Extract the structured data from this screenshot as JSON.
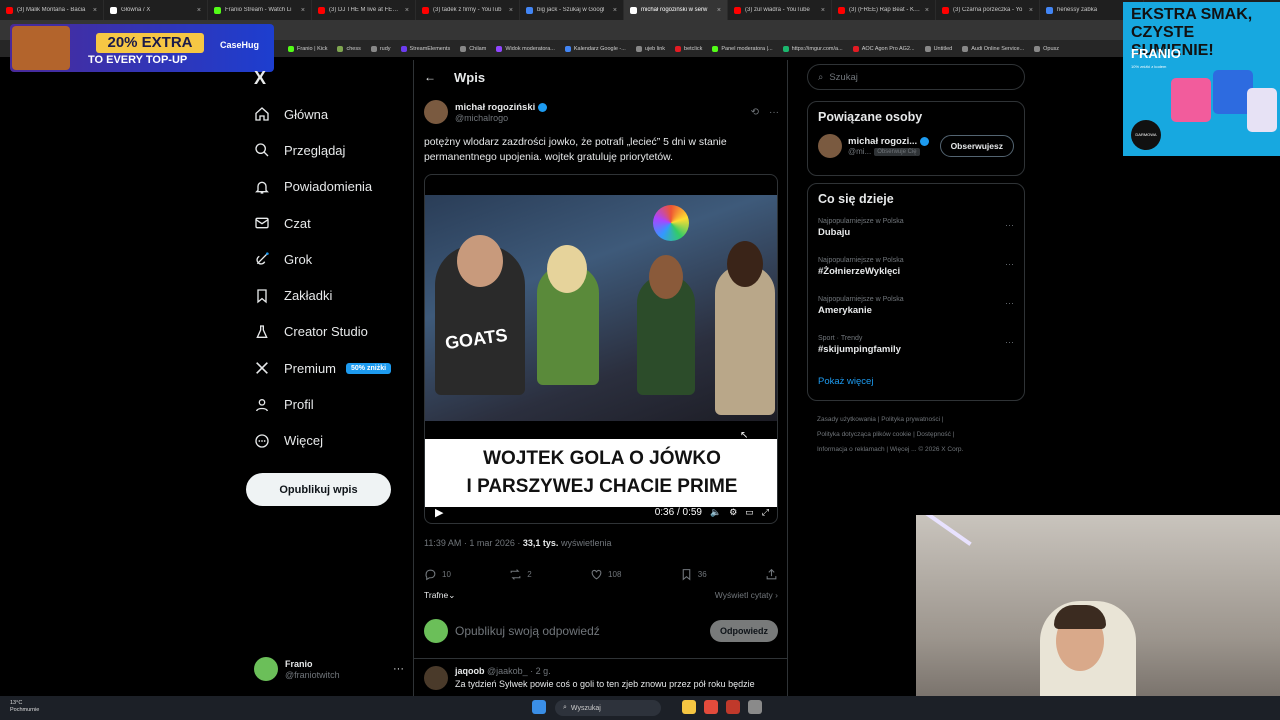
{
  "browser": {
    "tabs": [
      {
        "title": "(3) Malik Montana - Bacia",
        "color": "#ff0000"
      },
      {
        "title": "Główna / X",
        "color": "#ffffff"
      },
      {
        "title": "Franio Stream - Watch Li",
        "color": "#53fc18"
      },
      {
        "title": "(3) DJ THE M live at FESTI",
        "color": "#ff0000"
      },
      {
        "title": "(3) tadek z firmy - YouTub",
        "color": "#ff0000"
      },
      {
        "title": "big jack - Szukaj w Googl",
        "color": "#4285f4"
      },
      {
        "title": "michał rogoziński w serw",
        "color": "#ffffff",
        "active": true
      },
      {
        "title": "(3) zul wiadra - YouTube",
        "color": "#ff0000"
      },
      {
        "title": "(3) (FREE) Rap Beat - Killa",
        "color": "#ff0000"
      },
      {
        "title": "(3) Czarna porzeczka - Yo",
        "color": "#ff0000"
      },
      {
        "title": "henessy żabka",
        "color": "#4285f4"
      }
    ],
    "bookmarks": [
      {
        "label": "Franio | Kick",
        "color": "#53fc18"
      },
      {
        "label": "chess",
        "color": "#7fa650"
      },
      {
        "label": "rudy",
        "color": "#888888"
      },
      {
        "label": "StreamElements",
        "color": "#6c3cf0"
      },
      {
        "label": "Chilam",
        "color": "#888888"
      },
      {
        "label": "Widok moderatora...",
        "color": "#9146ff"
      },
      {
        "label": "Kalendarz Google -...",
        "color": "#4285f4"
      },
      {
        "label": "ujeb link",
        "color": "#888888"
      },
      {
        "label": "betclick",
        "color": "#e31b23"
      },
      {
        "label": "Panel moderatora |...",
        "color": "#53fc18"
      },
      {
        "label": "https://imgur.com/a...",
        "color": "#1bb76e"
      },
      {
        "label": "AOC Agon Pro AG2...",
        "color": "#e31b23"
      },
      {
        "label": "Untitled",
        "color": "#888888"
      },
      {
        "label": "Audi Online Service...",
        "color": "#888888"
      },
      {
        "label": "Opusz",
        "color": "#888888"
      }
    ]
  },
  "overlay": {
    "promo_percent": "20% EXTRA",
    "promo_sub": "TO EVERY TOP-UP",
    "promo_brand": "CaseHug",
    "ad_line1": "EKSTRA SMAK,",
    "ad_line2": "CZYSTE SUMIENIE!",
    "ad_brand": "FRANIO",
    "ad_small": "10% zniżki z kodem",
    "ad_badge": "DARMOWA WYSYŁKA!"
  },
  "nav": {
    "logo": "X",
    "items": [
      {
        "label": "Główna",
        "icon": "home-icon"
      },
      {
        "label": "Przeglądaj",
        "icon": "search-icon"
      },
      {
        "label": "Powiadomienia",
        "icon": "bell-icon"
      },
      {
        "label": "Czat",
        "icon": "mail-icon"
      },
      {
        "label": "Grok",
        "icon": "grok-icon"
      },
      {
        "label": "Zakładki",
        "icon": "bookmark-icon"
      },
      {
        "label": "Creator Studio",
        "icon": "flask-icon"
      },
      {
        "label": "Premium",
        "icon": "x-icon",
        "badge": "50% zniżki"
      },
      {
        "label": "Profil",
        "icon": "person-icon"
      },
      {
        "label": "Więcej",
        "icon": "more-icon"
      }
    ],
    "post_button": "Opublikuj wpis",
    "me_name": "Franio",
    "me_handle": "@franiotwitch"
  },
  "main": {
    "header": "Wpis",
    "author_name": "michał rogoziński",
    "author_handle": "@michalrogo",
    "text": "potężny wlodarz zazdrości jowko, że potrafi „lecieć” 5 dni w stanie permanentnego upojenia. wojtek gratuluję priorytetów.",
    "video_overlay_text": "GOATS",
    "caption_line1": "WOJTEK GOLA O JÓWKO",
    "caption_line2": "I PARSZYWEJ CHACIE PRIME",
    "video_time": "0:36 / 0:59",
    "meta_time": "11:39 AM · 1 mar 2026 ·",
    "meta_views": "33,1 tys.",
    "meta_views_label": "wyświetlenia",
    "actions": {
      "replies": "10",
      "reposts": "2",
      "likes": "108",
      "bookmarks": "36"
    },
    "sort": "Trafne",
    "quotes": "Wyświetl cytaty",
    "reply_placeholder": "Opublikuj swoją odpowiedź",
    "reply_button": "Odpowiedz",
    "comment_name": "jaqoob",
    "comment_handle": "@jaakob_ · 2 g.",
    "comment_text": "Za tydzień Sylwek powie coś o goli to ten zjeb znowu przez pół roku będzie"
  },
  "right": {
    "search_placeholder": "Szukaj",
    "related_title": "Powiązane osoby",
    "related_name": "michał rogozi...",
    "related_handle": "@mi...",
    "follows_you": "Obserwuje Cię",
    "follow_button": "Obserwujesz",
    "trends_title": "Co się dzieje",
    "trends": [
      {
        "context": "Najpopularniejsze w Polska",
        "title": "Dubaju"
      },
      {
        "context": "Najpopularniejsze w Polska",
        "title": "#ŻołnierzeWyklęci"
      },
      {
        "context": "Najpopularniejsze w Polska",
        "title": "Amerykanie"
      },
      {
        "context": "Sport · Trendy",
        "title": "#skijumpingfamily"
      }
    ],
    "show_more": "Pokaż więcej",
    "footer": [
      "Zasady użytkowania",
      "Polityka prywatności",
      "Polityka dotycząca plików cookie",
      "Dostępność",
      "Informacja o reklamach",
      "Więcej ...",
      "© 2026 X Corp."
    ]
  },
  "taskbar": {
    "temp": "13°C",
    "weather": "Pochmurnie",
    "search": "Wyszukaj"
  }
}
